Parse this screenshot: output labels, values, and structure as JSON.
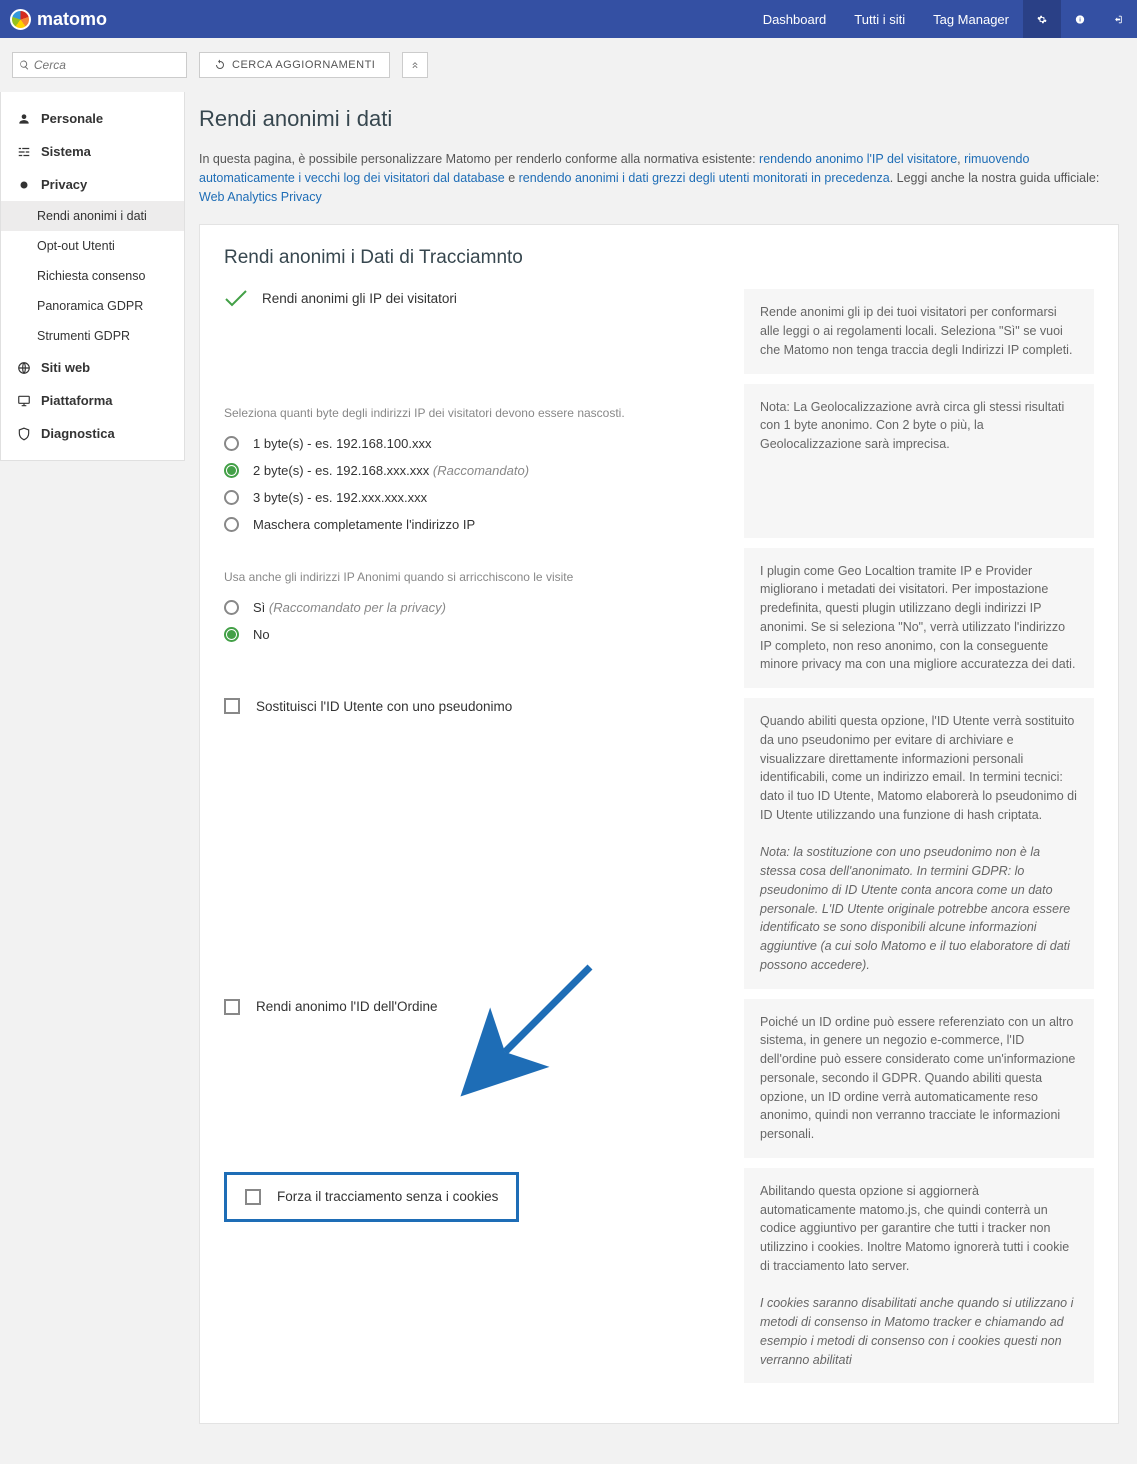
{
  "brand": "matomo",
  "topnav": {
    "dashboard": "Dashboard",
    "allsites": "Tutti i siti",
    "tagmanager": "Tag Manager"
  },
  "search": {
    "placeholder": "Cerca"
  },
  "updatebtn": "CERCA AGGIORNAMENTI",
  "sidebar": {
    "personal": "Personale",
    "system": "Sistema",
    "privacy": "Privacy",
    "privacy_items": {
      "anon": "Rendi anonimi i dati",
      "optout": "Opt-out Utenti",
      "consent": "Richiesta consenso",
      "gdproverview": "Panoramica GDPR",
      "gdprtools": "Strumenti GDPR"
    },
    "websites": "Siti web",
    "platform": "Piattaforma",
    "diagnostics": "Diagnostica"
  },
  "page": {
    "title": "Rendi anonimi i dati",
    "intro_pre": "In questa pagina, è possibile personalizzare Matomo per renderlo conforme alla normativa esistente: ",
    "link1": "rendendo anonimo l'IP del visitatore",
    "sep1": ", ",
    "link2": "rimuovendo automaticamente i vecchi log dei visitatori dal database",
    "sep2": " e ",
    "link3": "rendendo anonimi i dati grezzi degli utenti monitorati in precedenza",
    "intro_mid": ". Leggi anche la nostra guida ufficiale: ",
    "link4": "Web Analytics Privacy"
  },
  "card": {
    "title": "Rendi anonimi i Dati di Tracciamnto",
    "anonip_label": "Rendi anonimi gli IP dei visitatori",
    "anonip_help": "Rende anonimi gli ip dei tuoi visitatori per conformarsi alle leggi o ai regolamenti locali. Seleziona \"Sì\" se vuoi che Matomo non tenga traccia degli Indirizzi IP completi.",
    "bytes_label": "Seleziona quanti byte degli indirizzi IP dei visitatori devono essere nascosti.",
    "bytes_help": "Nota: La Geolocalizzazione avrà circa gli stessi risultati con 1 byte anonimo. Con 2 byte o più, la Geolocalizzazione sarà imprecisa.",
    "bytes_opts": {
      "b1": "1 byte(s) - es. 192.168.100.xxx",
      "b2": "2 byte(s) - es. 192.168.xxx.xxx",
      "b2_reco": "(Raccomandato)",
      "b3": "3 byte(s) - es. 192.xxx.xxx.xxx",
      "full": "Maschera completamente l'indirizzo IP"
    },
    "enrich_label": "Usa anche gli indirizzi IP Anonimi quando si arricchiscono le visite",
    "enrich_yes": "Sì",
    "enrich_yes_reco": "(Raccomandato per la privacy)",
    "enrich_no": "No",
    "enrich_help": "I plugin come Geo Localtion tramite IP e Provider migliorano i metadati dei visitatori. Per impostazione predefinita, questi plugin utilizzano degli indirizzi IP anonimi. Se si seleziona \"No\", verrà utilizzato l'indirizzo IP completo, non reso anonimo, con la conseguente minore privacy ma con una migliore accuratezza dei dati.",
    "userid_label": "Sostituisci l'ID Utente con uno pseudonimo",
    "userid_help": "Quando abiliti questa opzione, l'ID Utente verrà sostituito da uno pseudonimo per evitare di archiviare e visualizzare direttamente informazioni personali identificabili, come un indirizzo email. In termini tecnici: dato il tuo ID Utente, Matomo elaborerà lo pseudonimo di ID Utente utilizzando una funzione di hash criptata.",
    "userid_note": "Nota: la sostituzione con uno pseudonimo non è la stessa cosa dell'anonimato. In termini GDPR: lo pseudonimo di ID Utente conta ancora come un dato personale. L'ID Utente originale potrebbe ancora essere identificato se sono disponibili alcune informazioni aggiuntive (a cui solo Matomo e il tuo elaboratore di dati possono accedere).",
    "orderid_label": "Rendi anonimo l'ID dell'Ordine",
    "orderid_help": "Poiché un ID ordine può essere referenziato con un altro sistema, in genere un negozio e-commerce, l'ID dell'ordine può essere considerato come un'informazione personale, secondo il GDPR. Quando abiliti questa opzione, un ID ordine verrà automaticamente reso anonimo, quindi non verranno tracciate le informazioni personali.",
    "forcecookie_label": "Forza il tracciamento senza i cookies",
    "forcecookie_help": "Abilitando questa opzione si aggiornerà automaticamente matomo.js, che quindi conterrà un codice aggiuntivo per garantire che tutti i tracker non utilizzino i cookies. Inoltre Matomo ignorerà tutti i cookie di tracciamento lato server.",
    "forcecookie_note": "I cookies saranno disabilitati anche quando si utilizzano i metodi di consenso in Matomo tracker e chiamando ad esempio i metodi di consenso con i cookies questi non verranno abilitati"
  }
}
